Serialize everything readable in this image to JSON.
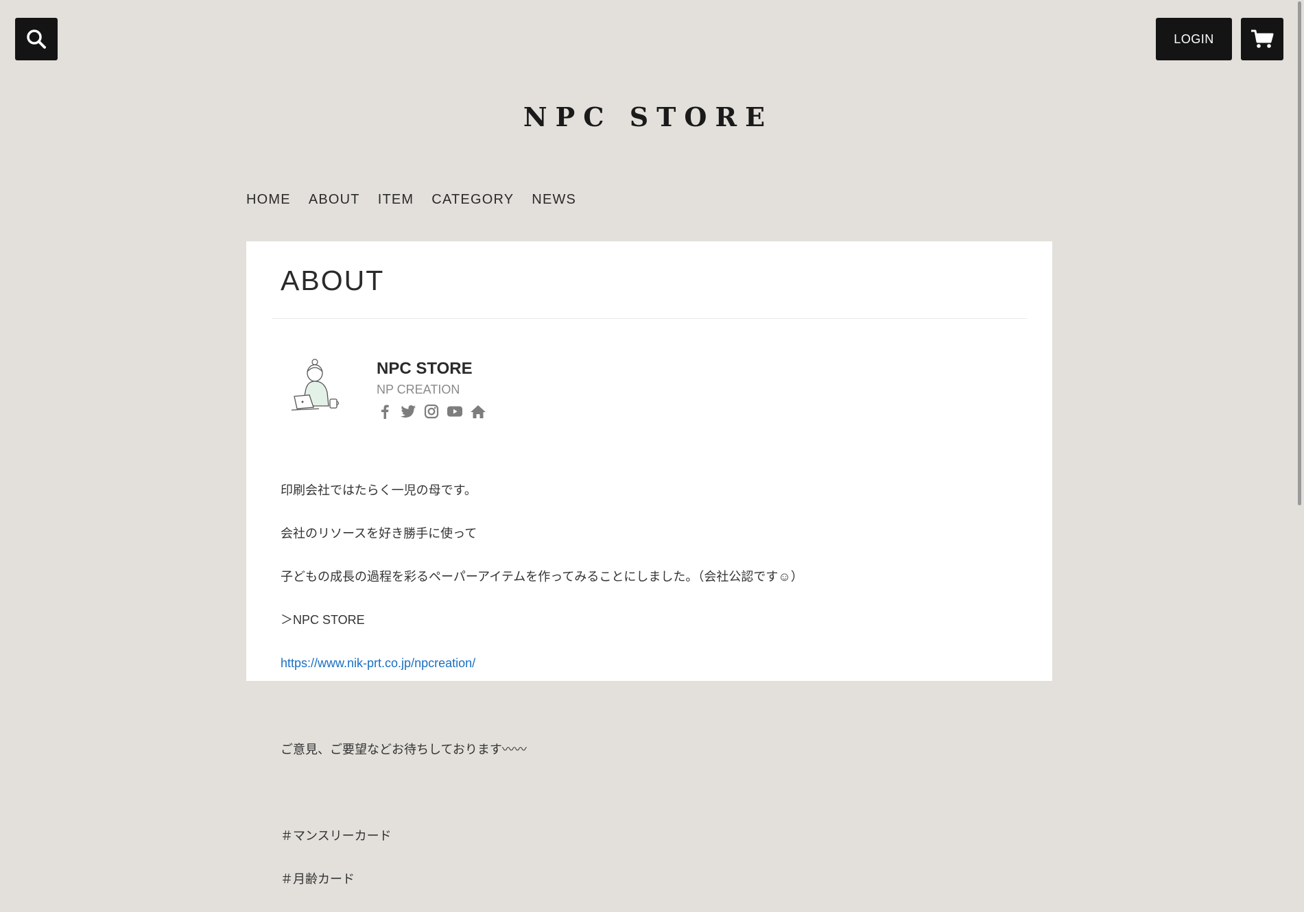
{
  "header": {
    "search_icon": "search-icon",
    "login_label": "LOGIN",
    "cart_icon": "cart-icon",
    "logo": "NPC STORE"
  },
  "nav": {
    "items": [
      {
        "label": "HOME"
      },
      {
        "label": "ABOUT"
      },
      {
        "label": "ITEM"
      },
      {
        "label": "CATEGORY"
      },
      {
        "label": "NEWS"
      }
    ]
  },
  "main": {
    "title": "ABOUT",
    "profile": {
      "name": "NPC STORE",
      "subtitle": "NP CREATION",
      "social_icons": [
        "facebook-icon",
        "twitter-icon",
        "instagram-icon",
        "youtube-icon",
        "home-icon"
      ]
    },
    "lines": [
      "印刷会社ではたらく一児の母です。",
      "会社のリソースを好き勝手に使って",
      "子どもの成長の過程を彩るペーパーアイテムを作ってみることにしました。（会社公認です☺）",
      "＞NPC STORE",
      "https://www.nik-prt.co.jp/npcreation/",
      "",
      "ご意見、ご要望などお待ちしております〰〰",
      "",
      "＃マンスリーカード",
      "＃月齢カード"
    ]
  },
  "colors": {
    "background": "#e3e0db",
    "button": "#141414",
    "link": "#1a6fc4"
  }
}
